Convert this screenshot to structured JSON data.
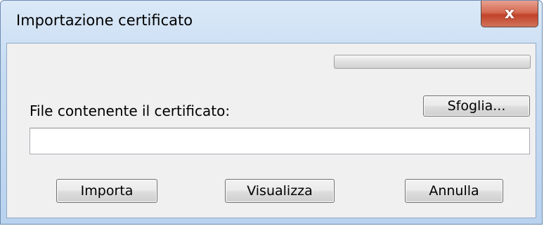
{
  "window": {
    "title": "Importazione certificato",
    "close_glyph": "x"
  },
  "progress": {
    "value_percent": 0
  },
  "file": {
    "label": "File contenente il certificato:",
    "value": "",
    "placeholder": ""
  },
  "buttons": {
    "browse_label": "Sfoglia...",
    "import_label": "Importa",
    "view_label": "Visualizza",
    "cancel_label": "Annulla"
  },
  "icons": {
    "close": "close-icon"
  },
  "colors": {
    "titlebar": "#c7dcf2",
    "close_button": "#c2432a",
    "client_bg": "#f0f0f0"
  }
}
